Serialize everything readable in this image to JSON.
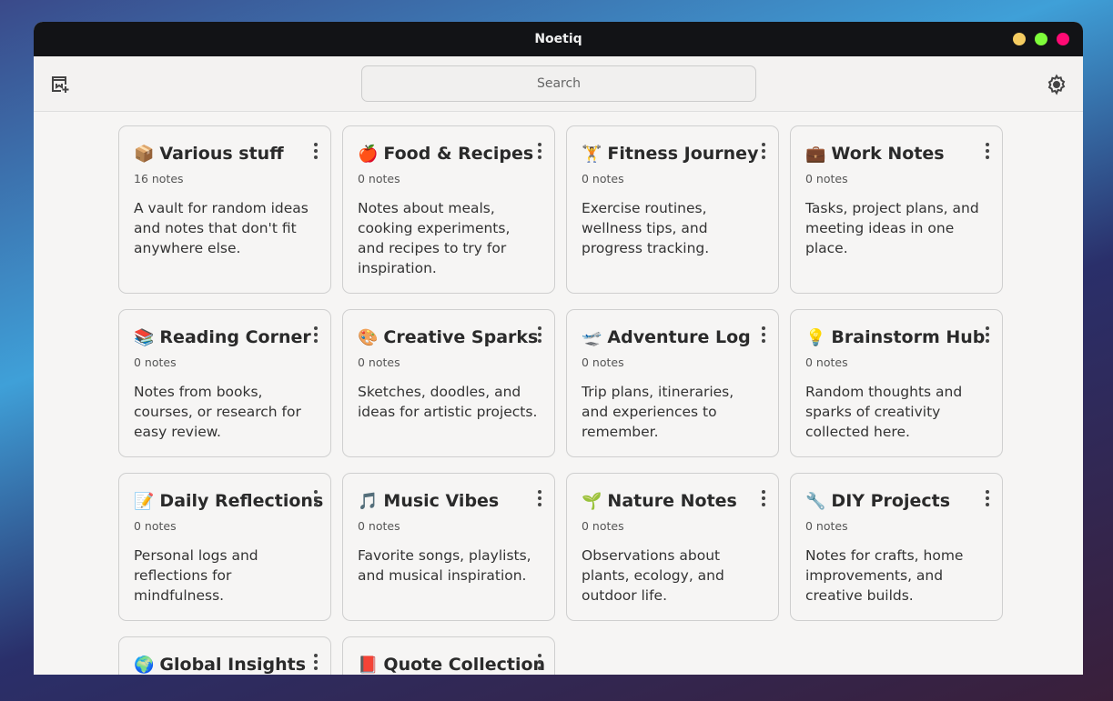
{
  "window": {
    "title": "Noetiq"
  },
  "toolbar": {
    "search_placeholder": "Search"
  },
  "colors": {
    "minimize": "#f4cc61",
    "maximize": "#7efc3a",
    "close": "#ff0a74"
  },
  "notebooks": [
    {
      "emoji": "📦",
      "title": "Various stuff",
      "count": "16 notes",
      "description": "A vault for random ideas and notes that don't fit anywhere else."
    },
    {
      "emoji": "🍎",
      "title": "Food & Recipes",
      "count": "0 notes",
      "description": "Notes about meals, cooking experiments, and recipes to try for inspiration."
    },
    {
      "emoji": "🏋️",
      "title": "Fitness Journey",
      "count": "0 notes",
      "description": "Exercise routines, wellness tips, and progress tracking."
    },
    {
      "emoji": "💼",
      "title": "Work Notes",
      "count": "0 notes",
      "description": "Tasks, project plans, and meeting ideas in one place."
    },
    {
      "emoji": "📚",
      "title": "Reading Corner",
      "count": "0 notes",
      "description": "Notes from books, courses, or research for easy review."
    },
    {
      "emoji": "🎨",
      "title": "Creative Sparks",
      "count": "0 notes",
      "description": "Sketches, doodles, and ideas for artistic projects."
    },
    {
      "emoji": "🛫",
      "title": "Adventure Log",
      "count": "0 notes",
      "description": "Trip plans, itineraries, and experiences to remember."
    },
    {
      "emoji": "💡",
      "title": "Brainstorm Hub",
      "count": "0 notes",
      "description": "Random thoughts and sparks of creativity collected here."
    },
    {
      "emoji": "📝",
      "title": "Daily Reflections",
      "count": "0 notes",
      "description": "Personal logs and reflections for mindfulness."
    },
    {
      "emoji": "🎵",
      "title": "Music Vibes",
      "count": "0 notes",
      "description": "Favorite songs, playlists, and musical inspiration."
    },
    {
      "emoji": "🌱",
      "title": "Nature Notes",
      "count": "0 notes",
      "description": "Observations about plants, ecology, and outdoor life."
    },
    {
      "emoji": "🔧",
      "title": "DIY Projects",
      "count": "0 notes",
      "description": "Notes for crafts, home improvements, and creative builds."
    },
    {
      "emoji": "🌍",
      "title": "Global Insights",
      "count": "",
      "description": ""
    },
    {
      "emoji": "📕",
      "title": "Quote Collection",
      "count": "",
      "description": ""
    }
  ]
}
